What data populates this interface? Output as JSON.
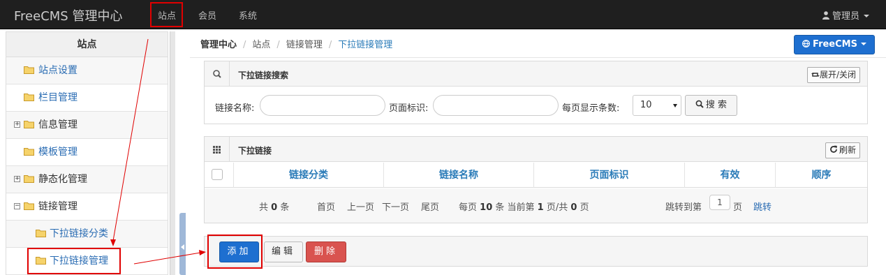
{
  "navbar": {
    "brand": "FreeCMS 管理中心",
    "items": [
      "站点",
      "会员",
      "系统"
    ],
    "user": "管理员"
  },
  "sidebar": {
    "title": "站点",
    "items": [
      {
        "label": "站点设置"
      },
      {
        "label": "栏目管理"
      },
      {
        "label": "信息管理",
        "expander": "+"
      },
      {
        "label": "模板管理"
      },
      {
        "label": "静态化管理",
        "expander": "+"
      },
      {
        "label": "链接管理",
        "expander": "−"
      },
      {
        "label": "下拉链接分类"
      },
      {
        "label": "下拉链接管理"
      }
    ]
  },
  "breadcrumb": [
    "管理中心",
    "站点",
    "链接管理",
    "下拉链接管理"
  ],
  "site_button": "FreeCMS",
  "search_panel": {
    "title": "下拉链接搜索",
    "toggle_label": "展开/关闭",
    "name_label": "链接名称:",
    "name_value": "",
    "key_label": "页面标识:",
    "key_value": "",
    "pagesize_label": "每页显示条数:",
    "pagesize_value": "10",
    "search_label": "搜 索"
  },
  "list_panel": {
    "title": "下拉链接",
    "refresh_label": "刷新",
    "columns": [
      "链接分类",
      "链接名称",
      "页面标识",
      "有效",
      "顺序"
    ],
    "pager": {
      "total_prefix": "共",
      "total": "0",
      "total_suffix": "条",
      "first": "首页",
      "prev": "上一页",
      "next": "下一页",
      "last": "尾页",
      "per_page_prefix": "每页",
      "per_page": "10",
      "per_page_mid": "条 当前第",
      "current": "1",
      "page_of": "页/共",
      "pages": "0",
      "pages_suffix": "页",
      "jump_prefix": "跳转到第",
      "jump_value": "1",
      "jump_suffix": "页",
      "jump_link": "跳转"
    }
  },
  "actions": {
    "add": "添加",
    "edit": "编辑",
    "delete": "删除"
  },
  "colors": {
    "primary": "#1e6fd0",
    "danger": "#d9534f",
    "annotation": "#e00000",
    "link": "#2a7bb8"
  }
}
